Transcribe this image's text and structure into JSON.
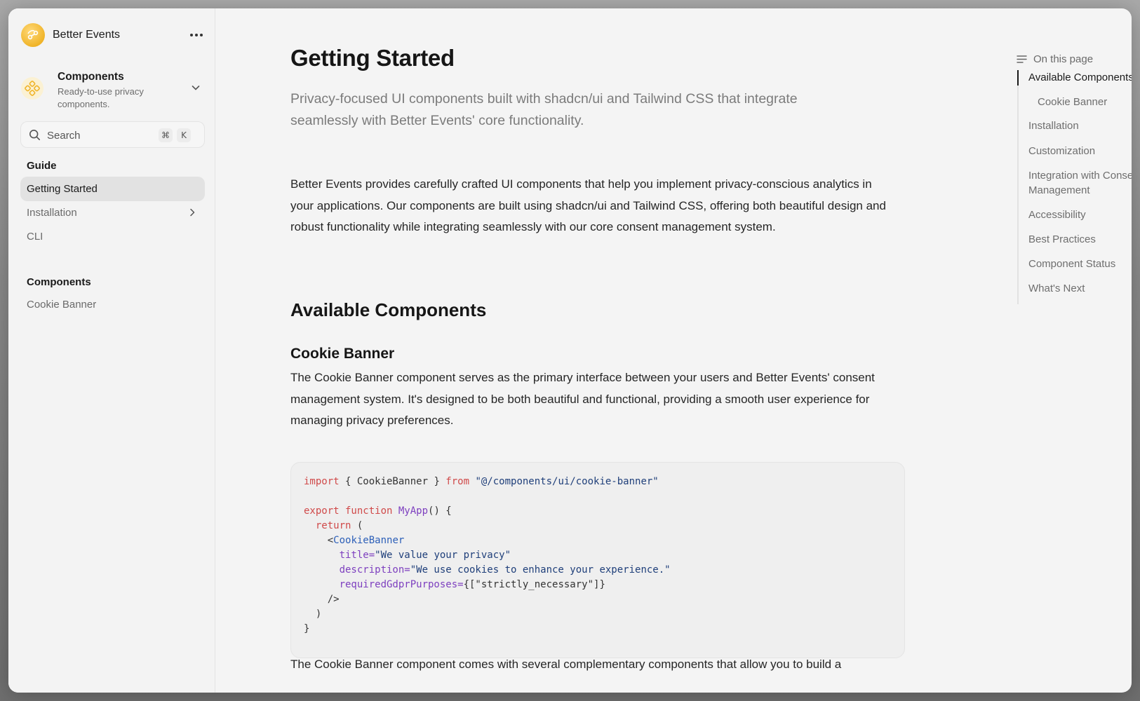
{
  "brand": {
    "name": "Better Events"
  },
  "switcher": {
    "title": "Components",
    "subtitle": "Ready-to-use privacy components."
  },
  "search": {
    "placeholder": "Search",
    "shortcut_mod": "⌘",
    "shortcut_key": "K"
  },
  "sidebar": {
    "sections": [
      {
        "heading": "Guide",
        "items": [
          "Getting Started",
          "Installation",
          "CLI"
        ]
      },
      {
        "heading": "Components",
        "items": [
          "Cookie Banner"
        ]
      }
    ]
  },
  "main": {
    "title": "Getting Started",
    "lead": "Privacy-focused UI components built with shadcn/ui and Tailwind CSS that integrate seamlessly with Better Events' core functionality.",
    "intro": "Better Events provides carefully crafted UI components that help you implement privacy-conscious analytics in your applications. Our components are built using shadcn/ui and Tailwind CSS, offering both beautiful design and robust functionality while integrating seamlessly with our core consent management system.",
    "h2": "Available Components",
    "h3": "Cookie Banner",
    "cookie_para": "The Cookie Banner component serves as the primary interface between your users and Better Events' consent management system. It's designed to be both beautiful and functional, providing a smooth user experience for managing privacy preferences.",
    "code": {
      "l1_import": "import",
      "l1_names": " { CookieBanner } ",
      "l1_from": "from",
      "l1_path": " \"@/components/ui/cookie-banner\"",
      "l3_export": "export",
      "l3_function": " function",
      "l3_name": " MyApp",
      "l3_rest": "() {",
      "l4_return": "  return",
      "l4_rest": " (",
      "l5_open": "    <",
      "l5_tag": "CookieBanner",
      "l6_attr": "      title=",
      "l6_val": "\"We value your privacy\"",
      "l7_attr": "      description=",
      "l7_val": "\"We use cookies to enhance your experience.\"",
      "l8_attr": "      requiredGdprPurposes=",
      "l8_val": "{[\"strictly_necessary\"]}",
      "l9": "    />",
      "l10": "  )",
      "l11": "}"
    },
    "bottom_para": "The Cookie Banner component comes with several complementary components that allow you to build a"
  },
  "toc": {
    "heading": "On this page",
    "items": [
      "Available Components",
      "Cookie Banner",
      "Installation",
      "Customization",
      "Integration with Consent Management",
      "Accessibility",
      "Best Practices",
      "Component Status",
      "What's Next"
    ]
  },
  "colors": {
    "accent": "#f0b429",
    "keyword": "#d04a4a",
    "string": "#1f3f7a",
    "function": "#7d3fbf",
    "jsx_tag": "#2c5fb8"
  }
}
